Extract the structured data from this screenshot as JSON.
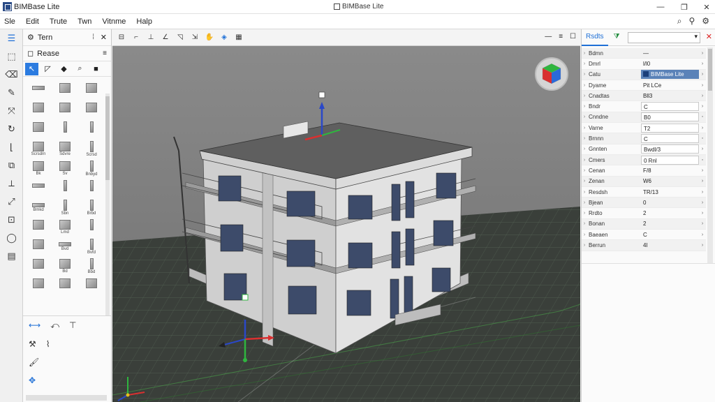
{
  "app": {
    "name": "BIMBase Lite",
    "window_title": "BIMBase Lite"
  },
  "window_controls": {
    "minimize": "—",
    "restore": "❐",
    "close": "✕"
  },
  "menu": {
    "items": [
      "Sle",
      "Edit",
      "Trute",
      "Twn",
      "Vitnme",
      "Halp"
    ]
  },
  "tool_panel": {
    "title": "Tern",
    "subtitle": "Rease",
    "element_labels": [
      "",
      "",
      "",
      "",
      "",
      "",
      "",
      "",
      "",
      "Scrsdrn",
      "Sdvre",
      "Scrsd",
      "Bk",
      "Sv",
      "Bnbyd",
      "",
      "",
      "",
      "Bmkd",
      "Sbn",
      "Brbd",
      "",
      "Lmd",
      "",
      "",
      "Bvd",
      "Bvfd",
      "",
      "Bd",
      "Bbd",
      "",
      "",
      ""
    ]
  },
  "properties": {
    "tab_label": "Rsdts",
    "rows": [
      {
        "label": "Bdmn",
        "value": "—",
        "style": "plain"
      },
      {
        "label": "Dmrl",
        "value": "l/l0",
        "style": "plain"
      },
      {
        "label": "Catu",
        "value": "BIMBase Lite",
        "style": "highlight"
      },
      {
        "label": "Dyame",
        "value": "Pit LCe",
        "style": "plain"
      },
      {
        "label": "Cnadtas",
        "value": "Bll3",
        "style": "plain"
      },
      {
        "label": "Bndr",
        "value": "C",
        "style": "box"
      },
      {
        "label": "Cnndne",
        "value": "B0",
        "style": "box"
      },
      {
        "label": "Varne",
        "value": "T2",
        "style": "box"
      },
      {
        "label": "Brnnn",
        "value": "C",
        "style": "box"
      },
      {
        "label": "Gnnten",
        "value": "Bwdl/3",
        "style": "box"
      },
      {
        "label": "Cmers",
        "value": "0  Rnl",
        "style": "box"
      },
      {
        "label": "Cenan",
        "value": "F/8",
        "style": "plain"
      },
      {
        "label": "Zenan",
        "value": "W6",
        "style": "plain"
      },
      {
        "label": "Resdsh",
        "value": "TR/13",
        "style": "plain"
      },
      {
        "label": "Bjean",
        "value": "0",
        "style": "plain"
      },
      {
        "label": "Rrdto",
        "value": "2",
        "style": "plain"
      },
      {
        "label": "Bonan",
        "value": "2",
        "style": "plain"
      },
      {
        "label": "Baeaen",
        "value": "C",
        "style": "plain"
      },
      {
        "label": "Berrun",
        "value": "4l",
        "style": "plain"
      }
    ]
  },
  "colors": {
    "accent": "#1e6fd6",
    "highlight_row": "#5a82b8",
    "viewport_bg": "#7b7b7b",
    "building_wall": "#d9d9d9",
    "roof": "#5f5f5f",
    "gizmo_x": "#d93030",
    "gizmo_y": "#2fb53f",
    "gizmo_z": "#2a48c8"
  }
}
